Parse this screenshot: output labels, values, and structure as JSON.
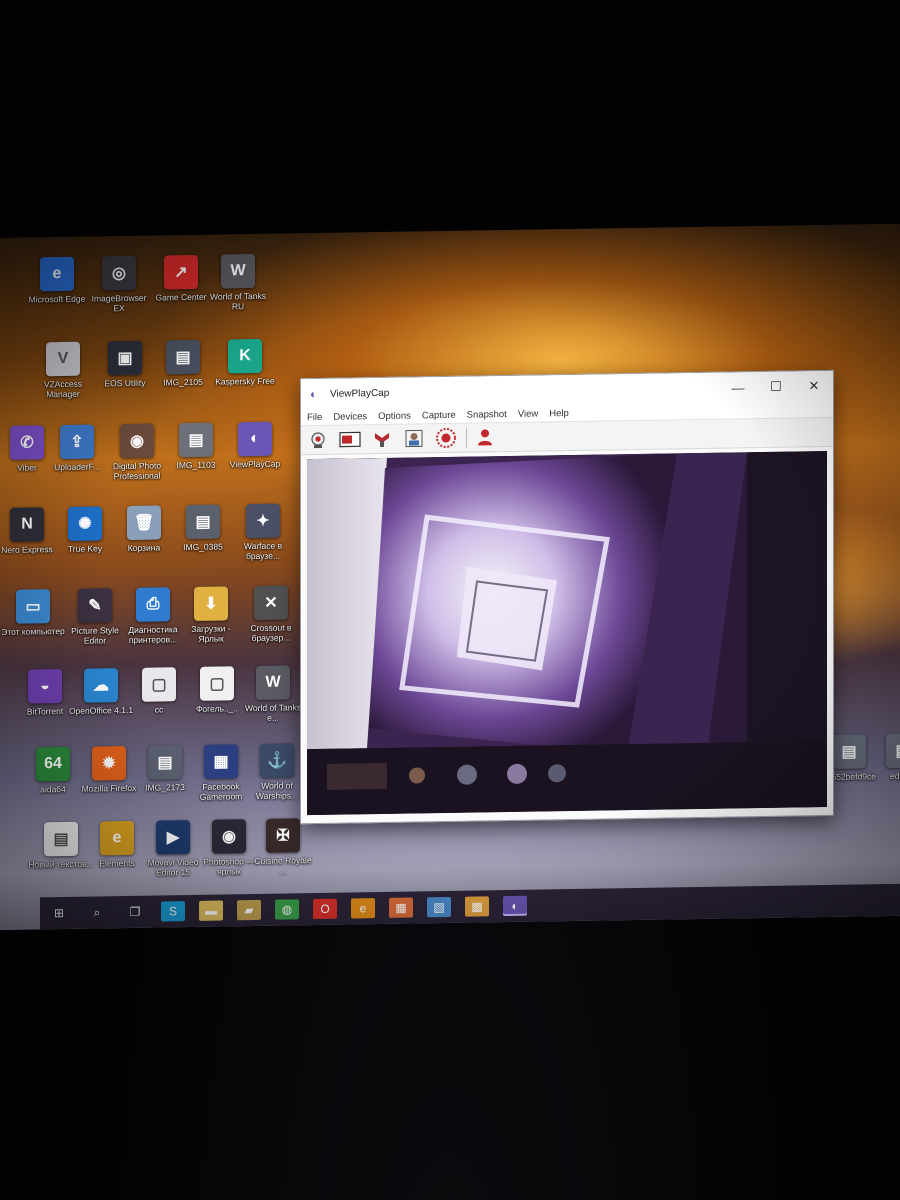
{
  "desktop": {
    "icons": [
      {
        "label": "Microsoft Edge",
        "glyph": "e",
        "color": "#2a6fd8"
      },
      {
        "label": "ImageBrowser EX",
        "glyph": "◎",
        "color": "#3a3a44"
      },
      {
        "label": "Game Center",
        "glyph": "↗",
        "color": "#d82a2a"
      },
      {
        "label": "World of Tanks RU",
        "glyph": "W",
        "color": "#5a5a62"
      },
      {
        "label": "VZAccess Manager",
        "glyph": "V",
        "color": "#c8c8d0"
      },
      {
        "label": "EOS Utility",
        "glyph": "▣",
        "color": "#2b2f3a"
      },
      {
        "label": "IMG_2105",
        "glyph": "▤",
        "color": "#4a5060"
      },
      {
        "label": "Kaspersky Free",
        "glyph": "K",
        "color": "#1aa58a"
      },
      {
        "label": "Viber",
        "glyph": "✆",
        "color": "#7b4fc9"
      },
      {
        "label": "UploaderF...",
        "glyph": "⇪",
        "color": "#3d78c8"
      },
      {
        "label": "Digital Photo Professional",
        "glyph": "◉",
        "color": "#6a4a3a"
      },
      {
        "label": "IMG_1103",
        "glyph": "▤",
        "color": "#6d7078"
      },
      {
        "label": "ViewPlayCap",
        "glyph": "◐",
        "color": "#6b55b5"
      },
      {
        "label": "Nero Express",
        "glyph": "N",
        "color": "#2f2f38"
      },
      {
        "label": "True Key",
        "glyph": "✺",
        "color": "#1d6fc8"
      },
      {
        "label": "Корзина",
        "glyph": "🗑",
        "color": "#8aa0b8"
      },
      {
        "label": "IMG_0385",
        "glyph": "▤",
        "color": "#5a606c"
      },
      {
        "label": "Warface в браузе...",
        "glyph": "✦",
        "color": "#4a4f66"
      },
      {
        "label": "Этот компьютер",
        "glyph": "▭",
        "color": "#3b8ad0"
      },
      {
        "label": "Picture Style Editor",
        "glyph": "✎",
        "color": "#3a3040"
      },
      {
        "label": "Диагностика принтеров...",
        "glyph": "⎙",
        "color": "#2f7bd0"
      },
      {
        "label": "Загрузки - Ярлык",
        "glyph": "⬇",
        "color": "#e0b040"
      },
      {
        "label": "Crossout в браузер...",
        "glyph": "✕",
        "color": "#505050"
      },
      {
        "label": "BitTorrent",
        "glyph": "◒",
        "color": "#6f3fb0"
      },
      {
        "label": "OpenOffice 4.1.1",
        "glyph": "☁",
        "color": "#2a86d0"
      },
      {
        "label": "cc",
        "glyph": "▢",
        "color": "#e8e8ec"
      },
      {
        "label": "Фогель.._..",
        "glyph": "▢",
        "color": "#f0f0f0"
      },
      {
        "label": "World of Tanks e...",
        "glyph": "W",
        "color": "#5a5a62"
      },
      {
        "label": "aida64",
        "glyph": "64",
        "color": "#2a8a3a"
      },
      {
        "label": "Mozilla Firefox",
        "glyph": "✹",
        "color": "#e0601a"
      },
      {
        "label": "IMG_2173",
        "glyph": "▤",
        "color": "#5a6070"
      },
      {
        "label": "Facebook Gameroom",
        "glyph": "▦",
        "color": "#2c3f80"
      },
      {
        "label": "World of Warships...",
        "glyph": "⚓",
        "color": "#3a4a66"
      },
      {
        "label": "Новый текстов...",
        "glyph": "▤",
        "color": "#eeeeee"
      },
      {
        "label": "Elements",
        "glyph": "e",
        "color": "#d8a020"
      },
      {
        "label": "Movavi Video Editor 15",
        "glyph": "▶",
        "color": "#1e3a6e"
      },
      {
        "label": "Photoshop — ярлык",
        "glyph": "◉",
        "color": "#2a2a38"
      },
      {
        "label": "Cuisine Royale ...",
        "glyph": "✠",
        "color": "#3a2a2a"
      },
      {
        "label": "55552befd9ce",
        "glyph": "▤",
        "color": "#6a7080"
      },
      {
        "label": "eda0...",
        "glyph": "▤",
        "color": "#6a7080"
      }
    ]
  },
  "window": {
    "title": "ViewPlayCap",
    "menu": [
      "File",
      "Devices",
      "Options",
      "Capture",
      "Snapshot",
      "View",
      "Help"
    ],
    "toolbar_icons": [
      "webcam-icon",
      "video-window-icon",
      "crossbar-icon",
      "snapshot-portrait-icon",
      "record-icon",
      "user-icon"
    ],
    "controls": {
      "minimize": "—",
      "maximize": "☐",
      "close": "✕"
    }
  },
  "taskbar": {
    "icons": [
      "start-icon",
      "search-icon",
      "task-view-icon",
      "skype-icon",
      "file-explorer-icon",
      "folder-icon",
      "chrome-icon",
      "opera-icon",
      "edge-icon",
      "store-icon",
      "photo-icon",
      "app-icon",
      "viewplaycap-icon"
    ]
  }
}
